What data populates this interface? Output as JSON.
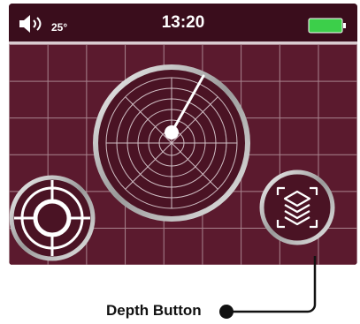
{
  "status_bar": {
    "temperature": "25°",
    "time": "13:20",
    "speaker_icon": "speaker-icon",
    "battery_icon": "battery-icon",
    "battery_color": "#3ccf4a"
  },
  "screen": {
    "background_color": "#5b1a2e",
    "grid_color": "#a9848f"
  },
  "controls": {
    "radar_icon": "radar-icon",
    "target_icon": "crosshair-target-icon",
    "depth_icon": "layers-icon"
  },
  "callout": {
    "label": "Depth Button"
  }
}
